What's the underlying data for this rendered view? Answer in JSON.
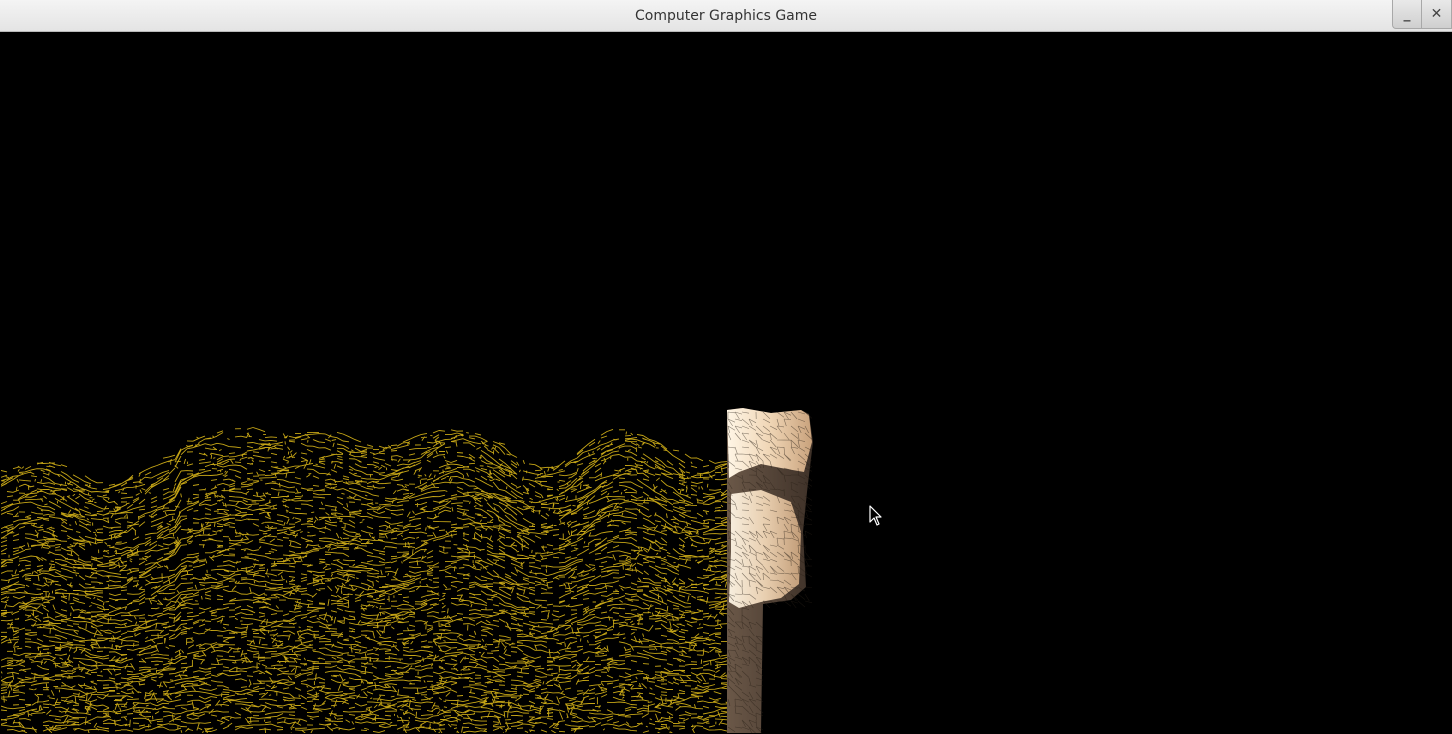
{
  "window": {
    "title": "Computer Graphics Game",
    "controls": {
      "minimize_glyph": "_",
      "close_glyph": "✕"
    }
  },
  "scene": {
    "background_color": "#000000",
    "terrain_wire_color": "#e8c21a",
    "cliff_color_light": "#f3dcc0",
    "cliff_color_dark": "#5a4a3c"
  },
  "icons": {
    "cursor": "mouse-pointer-icon",
    "minimize": "minimize-icon",
    "close": "close-icon"
  }
}
